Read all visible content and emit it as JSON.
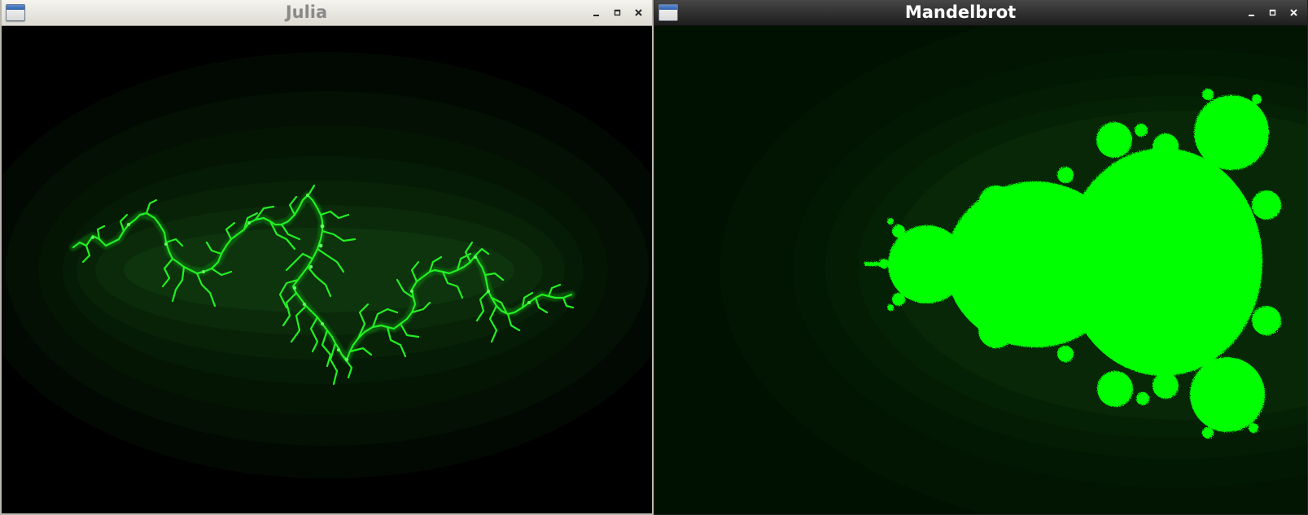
{
  "windows": [
    {
      "id": "julia",
      "title": "Julia",
      "theme": "light",
      "controls": [
        "minimize-icon",
        "maximize-icon",
        "close-icon"
      ],
      "fractal_color": "#22f022"
    },
    {
      "id": "mandelbrot",
      "title": "Mandelbrot",
      "theme": "dark",
      "controls": [
        "minimize-icon",
        "maximize-icon",
        "close-icon"
      ],
      "fractal_color": "#00ff00"
    }
  ],
  "colors": {
    "background_black": "#000000",
    "mandel_background": "#011101",
    "fractal_green": "#00ff00",
    "glow_green": "#0b3a0b"
  }
}
